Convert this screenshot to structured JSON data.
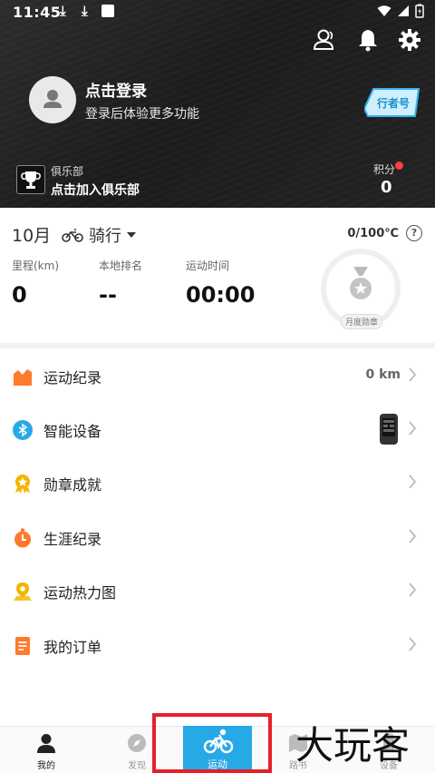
{
  "status_bar": {
    "time": "11:45",
    "download_1": "⤓",
    "download_2": "⤓"
  },
  "header": {
    "login_title": "点击登录",
    "login_subtitle": "登录后体验更多功能",
    "rider_badge": "行者号",
    "club_label": "俱乐部",
    "club_action": "点击加入俱乐部",
    "points_label": "积分",
    "points_value": "0"
  },
  "stats": {
    "month": "10月",
    "sport": "骑行",
    "temperature": "0/100℃",
    "help": "?",
    "mileage_label": "里程(km)",
    "mileage_value": "0",
    "rank_label": "本地排名",
    "rank_value": "--",
    "time_label": "运动时间",
    "time_value": "00:00",
    "medal_label": "月度勋章"
  },
  "menu": [
    {
      "label": "运动纪录",
      "extra": "0 km",
      "icon": "chart-icon"
    },
    {
      "label": "智能设备",
      "extra": "",
      "icon": "bluetooth-icon"
    },
    {
      "label": "勋章成就",
      "extra": "",
      "icon": "medal-icon"
    },
    {
      "label": "生涯纪录",
      "extra": "",
      "icon": "stopwatch-icon"
    },
    {
      "label": "运动热力图",
      "extra": "",
      "icon": "map-pin-icon"
    },
    {
      "label": "我的订单",
      "extra": "",
      "icon": "order-icon"
    }
  ],
  "nav": {
    "mine": "我的",
    "discover": "发现",
    "sport": "运动",
    "route": "路书",
    "device": "设备"
  },
  "watermark": "大玩客",
  "colors": {
    "accent": "#27a9e6",
    "orange": "#ff7a2a",
    "yellow": "#f5b400",
    "red_frame": "#e5202a"
  }
}
